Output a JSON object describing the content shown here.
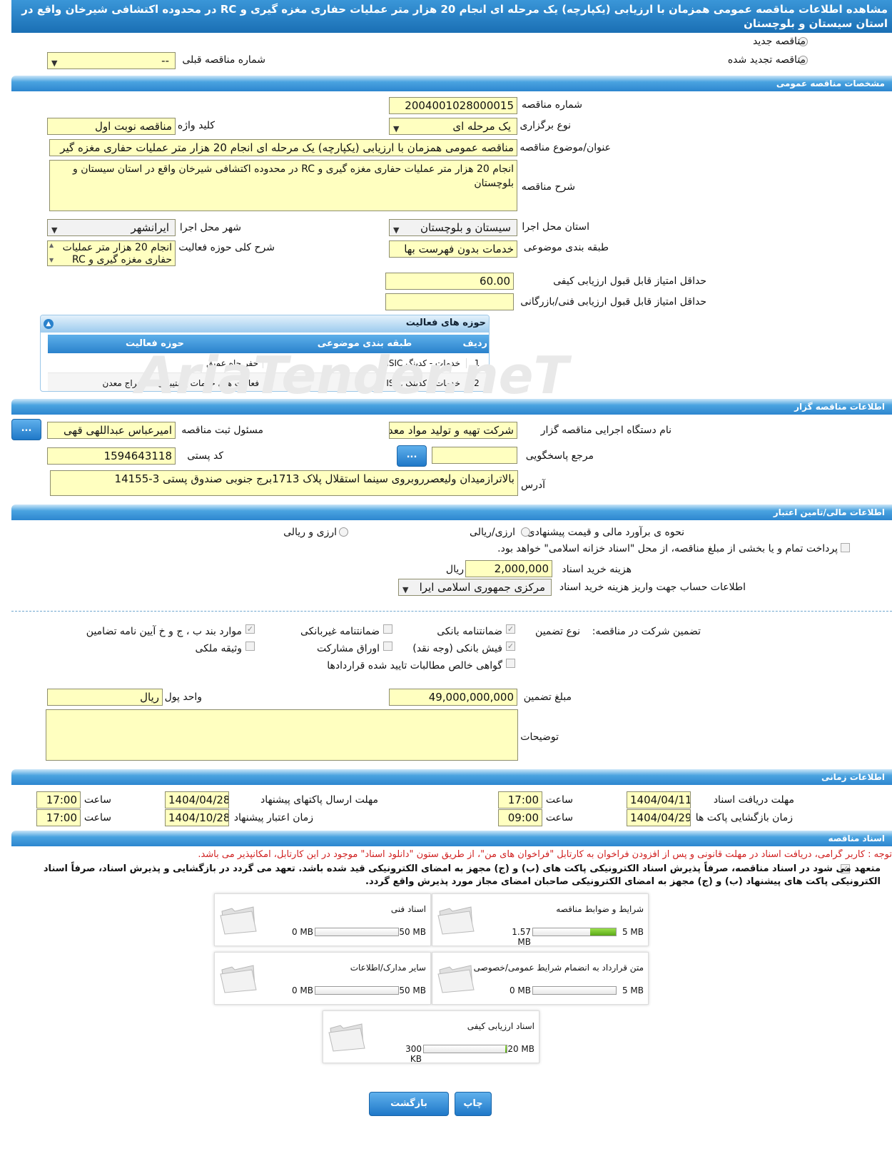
{
  "title": "مشاهده اطلاعات مناقصه عمومی همزمان با ارزیابی (یکپارچه) یک مرحله ای انجام 20 هزار متر عملیات حفاری مغزه گیری و RC در محدوده اکتشافی شیرخان واقع در استان سیستان و بلوچستان",
  "top": {
    "new_tender": "مناقصه جدید",
    "renewed_tender": "مناقصه تجدید شده",
    "prev_number_label": "شماره مناقصه قبلی",
    "prev_number_value": "--"
  },
  "general": {
    "header": "مشخصات مناقصه عمومی",
    "number_label": "شماره مناقصه",
    "number_value": "2004001028000015",
    "type_label": "نوع برگزاری",
    "type_value": "یک مرحله ای",
    "keyword_label": "کلید واژه",
    "keyword_value": "مناقصه نوبت اول",
    "subject_label": "عنوان/موضوع مناقصه",
    "subject_value": "مناقصه عمومی همزمان با ارزیابی (یکپارچه) یک مرحله ای انجام 20 هزار متر عملیات حفاری مغزه گیر",
    "desc_label": "شرح مناقصه",
    "desc_value": "انجام 20 هزار متر عملیات حفاری مغزه گیری و RC در محدوده اکتشافی شیرخان واقع در استان سیستان و بلوچستان",
    "province_label": "استان محل اجرا",
    "province_value": "سیستان و بلوچستان",
    "city_label": "شهر محل اجرا",
    "city_value": "ایرانشهر",
    "category_label": "طبقه بندی موضوعی",
    "category_value": "خدمات بدون فهرست بها",
    "scope_label": "شرح کلی حوزه فعالیت",
    "scope_value": "انجام 20 هزار متر عملیات حفاری مغزه گیری و RC در",
    "min_quality_label": "حداقل امتیاز قابل قبول ارزیابی کیفی",
    "min_quality_value": "60.00",
    "min_tech_label": "حداقل امتیاز قابل قبول ارزیابی فنی/بازرگانی",
    "min_tech_value": ""
  },
  "activity": {
    "header": "حوزه های فعالیت",
    "columns": [
      "ردیف",
      "طبقه بندی موضوعی",
      "حوزه فعالیت"
    ],
    "rows": [
      [
        "1",
        "خدمات - کدینگ ISIC",
        "حفر چاه عمیق"
      ],
      [
        "2",
        "خدمات - کدینگ ISIC",
        "فعالیت های خدمات پشتیبانی استخراج معدن"
      ]
    ]
  },
  "watermark": "AriaTender.neT",
  "organizer": {
    "header": "اطلاعات مناقصه گزار",
    "org_label": "نام دستگاه اجرایی مناقصه گزار",
    "org_value": "شرکت تهیه و تولید مواد معد",
    "resp_label": "مسئول ثبت مناقصه",
    "resp_value": "امیرعباس عبداللهی قهی",
    "ref_label": "مرجع پاسخگویی",
    "ref_value": "",
    "postal_label": "کد پستی",
    "postal_value": "1594643118",
    "address_label": "آدرس",
    "address_value": "بالاترازمیدان ولیعصرروبروی سینما استقلال پلاک 1713برج جنوبی صندوق پستی 3-14155",
    "dots": "..."
  },
  "finance": {
    "header": "اطلاعات مالی/تامین اعتبار",
    "method_label": "نحوه ی برآورد مالی و قیمت پیشنهادی",
    "opt1": "ارزی/ریالی",
    "opt2": "ارزی و ریالی",
    "treasury_text": "پرداخت تمام و یا بخشی از مبلغ مناقصه، از محل \"اسناد خزانه اسلامی\" خواهد بود.",
    "doc_cost_label": "هزینه خرید اسناد",
    "doc_cost_value": "2,000,000",
    "doc_cost_unit": "ریال",
    "account_label": "اطلاعات حساب جهت واریز هزینه خرید اسناد",
    "account_value": "مرکزی جمهوری اسلامی ایرا"
  },
  "guarantee": {
    "label": "تضمین شرکت در مناقصه:",
    "type_label": "نوع تضمین",
    "bank_guarantee": "ضمانتنامه بانکی",
    "nonbank_guarantee": "ضمانتنامه غیربانکی",
    "items_bcd": "موارد بند ب ، ج و خ آیین نامه تضامین",
    "cash": "فیش بانکی (وجه نقد)",
    "bonds": "اوراق مشارکت",
    "property": "وثیقه ملکی",
    "claims": "گواهی خالص مطالبات تایید شده قراردادها",
    "amount_label": "مبلغ تضمین",
    "amount_value": "49,000,000,000",
    "currency_label": "واحد پول",
    "currency_value": "ریال",
    "notes_label": "توضیحات",
    "notes_value": ""
  },
  "timing": {
    "header": "اطلاعات زمانی",
    "receive_label": "مهلت دریافت اسناد",
    "receive_date": "1404/04/11",
    "receive_time": "17:00",
    "send_label": "مهلت ارسال پاکتهای پیشنهاد",
    "send_date": "1404/04/28",
    "send_time": "17:00",
    "open_label": "زمان بازگشایی پاکت ها",
    "open_date": "1404/04/29",
    "open_time": "09:00",
    "valid_label": "زمان اعتبار پیشنهاد",
    "valid_date": "1404/10/28",
    "valid_time": "17:00",
    "time_label": "ساعت"
  },
  "documents": {
    "header": "اسناد مناقصه",
    "notice": "توجه : کاربر گرامی، دریافت اسناد در مهلت قانونی و پس از افزودن فراخوان به کارتابل \"فراخوان های من\"، از طریق ستون \"دانلود اسناد\" موجود در این کارتابل، امکانپذیر می باشد.",
    "commit": "متعهد می شود در اسناد مناقصه، صرفاً پذیرش اسناد الکترونیکی پاکت های (ب) و (ج) مجهز به امضای الکترونیکی قید شده باشد. تعهد می گردد در بازگشایی و پذیرش اسناد، صرفاً اسناد الکترونیکی پاکت های پیشنهاد (ب) و (ج) مجهز به امضای الکترونیکی صاحبان امضای مجاز مورد پذیرش واقع گردد.",
    "cards": [
      {
        "title": "شرایط و ضوابط مناقصه",
        "current": "1.57 MB",
        "max": "5 MB",
        "fill": 0.31
      },
      {
        "title": "اسناد فنی",
        "current": "0 MB",
        "max": "50 MB",
        "fill": 0
      },
      {
        "title": "متن قرارداد به انضمام شرایط عمومی/خصوصی",
        "current": "0 MB",
        "max": "5 MB",
        "fill": 0
      },
      {
        "title": "سایر مدارک/اطلاعات",
        "current": "0 MB",
        "max": "50 MB",
        "fill": 0
      },
      {
        "title": "اسناد ارزیابی کیفی",
        "current": "300 KB",
        "max": "20 MB",
        "fill": 0.015
      }
    ]
  },
  "actions": {
    "print": "چاپ",
    "back": "بازگشت"
  }
}
